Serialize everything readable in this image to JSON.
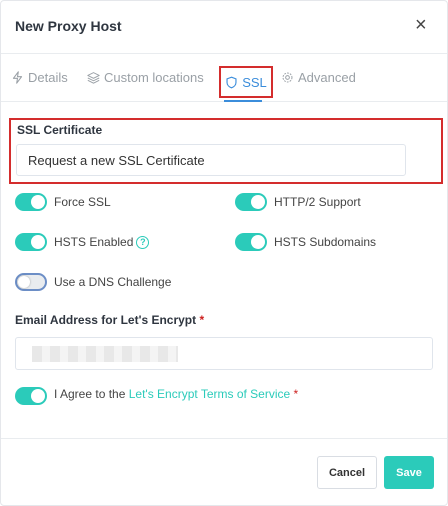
{
  "header": {
    "title": "New Proxy Host",
    "close_glyph": "×"
  },
  "tabs": [
    {
      "label": "Details",
      "icon": "lightning-icon"
    },
    {
      "label": "Custom locations",
      "icon": "layers-icon"
    },
    {
      "label": "SSL",
      "icon": "shield-icon",
      "active": true
    },
    {
      "label": "Advanced",
      "icon": "gear-icon"
    }
  ],
  "ssl": {
    "label": "SSL Certificate",
    "selected": "Request a new SSL Certificate"
  },
  "toggles": {
    "force_ssl": {
      "label": "Force SSL",
      "on": true
    },
    "http2": {
      "label": "HTTP/2 Support",
      "on": true
    },
    "hsts": {
      "label": "HSTS Enabled",
      "on": true
    },
    "hsts_sub": {
      "label": "HSTS Subdomains",
      "on": true
    },
    "dns": {
      "label": "Use a DNS Challenge",
      "on": false
    },
    "agree": {
      "on": true
    }
  },
  "email": {
    "label": "Email Address for Let's Encrypt",
    "required_mark": "*",
    "value": ""
  },
  "agree": {
    "prefix": "I Agree to the ",
    "link": "Let's Encrypt Terms of Service",
    "required_mark": "*"
  },
  "footer": {
    "cancel_label": "Cancel",
    "save_label": "Save"
  },
  "colors": {
    "accent": "#2bcbba",
    "tab_active": "#3b8ddb",
    "highlight": "#d42d2d"
  }
}
